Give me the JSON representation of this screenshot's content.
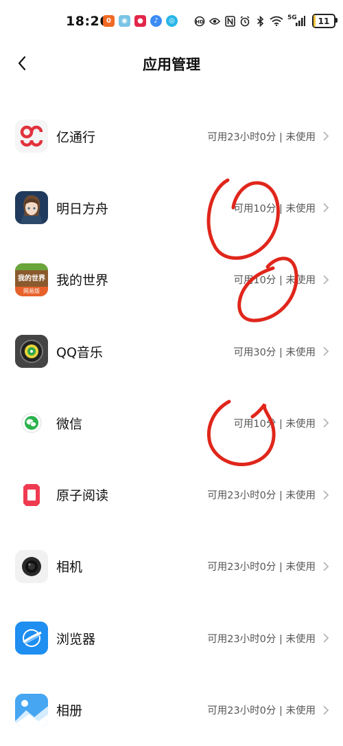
{
  "status_bar": {
    "time": "18:26",
    "network": "5G",
    "battery": "11",
    "battery_level": 0.11,
    "notification_icons": [
      "orange-app-icon",
      "maps-icon",
      "game-icon",
      "music-icon",
      "browser-icon"
    ],
    "system_icons": [
      "hd-icon",
      "eye-icon",
      "nfc-icon",
      "alarm-icon",
      "bluetooth-icon",
      "wifi-icon",
      "signal-icon"
    ]
  },
  "header": {
    "title": "应用管理"
  },
  "apps": [
    {
      "name": "亿通行",
      "status": "可用23小时0分 | 未使用",
      "icon": "yitongxing-icon"
    },
    {
      "name": "明日方舟",
      "status": "可用10分 | 未使用",
      "icon": "arknights-icon"
    },
    {
      "name": "我的世界",
      "status": "可用10分 | 未使用",
      "icon": "minecraft-icon",
      "icon_text": "我的世界",
      "icon_subtext": "网易版"
    },
    {
      "name": "QQ音乐",
      "status": "可用30分 | 未使用",
      "icon": "qq-music-icon"
    },
    {
      "name": "微信",
      "status": "可用10分 | 未使用",
      "icon": "wechat-icon"
    },
    {
      "name": "原子阅读",
      "status": "可用23小时0分 | 未使用",
      "icon": "atom-reader-icon"
    },
    {
      "name": "相机",
      "status": "可用23小时0分 | 未使用",
      "icon": "camera-icon"
    },
    {
      "name": "浏览器",
      "status": "可用23小时0分 | 未使用",
      "icon": "browser-app-icon"
    },
    {
      "name": "相册",
      "status": "可用23小时0分 | 未使用",
      "icon": "gallery-icon"
    }
  ],
  "colors": {
    "annotation_red": "#e0261b",
    "battery_yellow": "#f3c53c",
    "text_secondary": "#555555",
    "chevron": "#b5b5b5"
  }
}
